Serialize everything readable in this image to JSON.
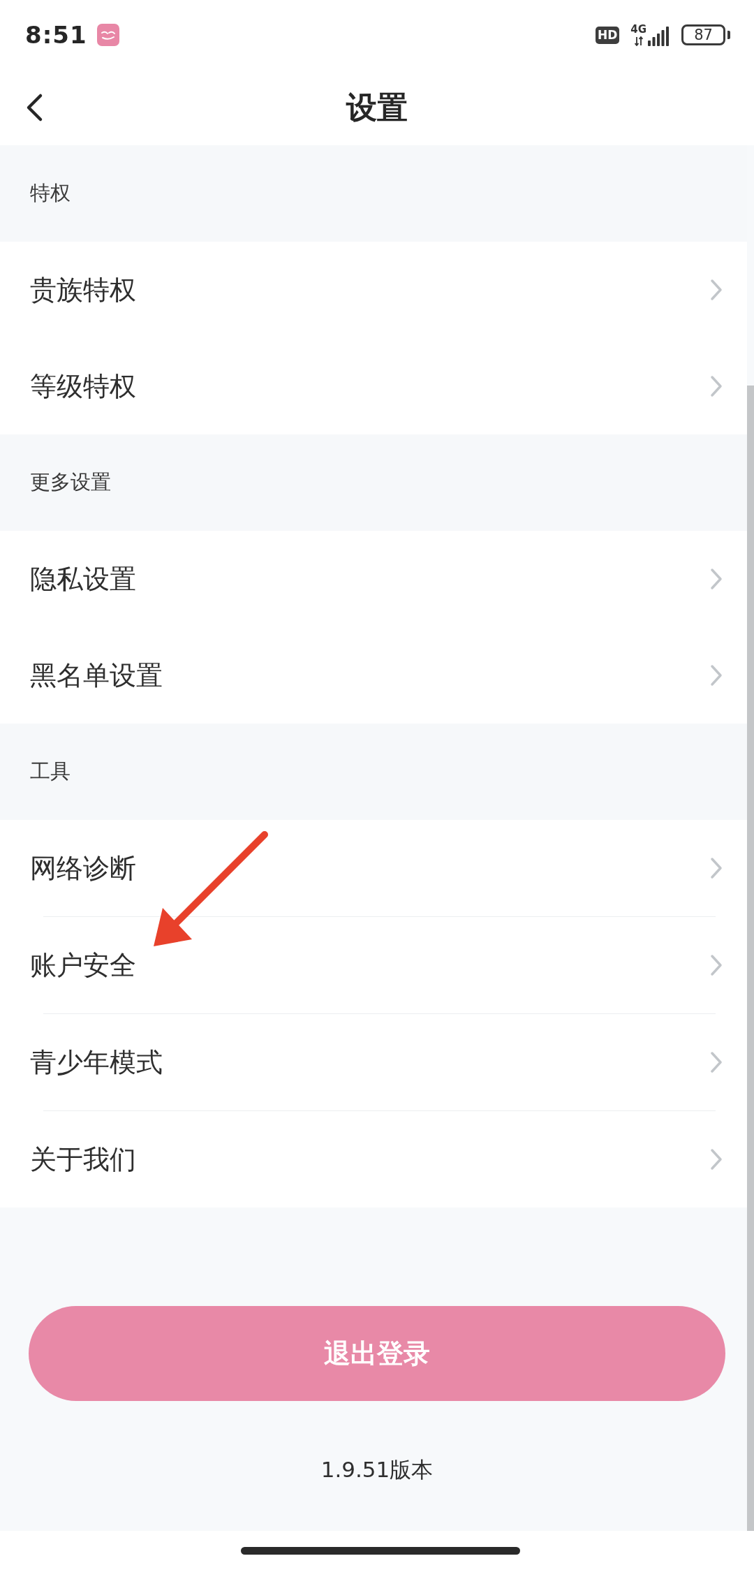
{
  "status_bar": {
    "time": "8:51",
    "hd": "HD",
    "network": "4G",
    "battery": "87"
  },
  "header": {
    "title": "设置"
  },
  "sections": [
    {
      "title": "特权",
      "dividers": false,
      "items": [
        {
          "label": "贵族特权"
        },
        {
          "label": "等级特权"
        }
      ]
    },
    {
      "title": "更多设置",
      "dividers": false,
      "items": [
        {
          "label": "隐私设置"
        },
        {
          "label": "黑名单设置"
        }
      ]
    },
    {
      "title": "工具",
      "dividers": true,
      "items": [
        {
          "label": "网络诊断"
        },
        {
          "label": "账户安全"
        },
        {
          "label": "青少年模式"
        },
        {
          "label": "关于我们"
        }
      ]
    }
  ],
  "logout_button": {
    "label": "退出登录"
  },
  "version": "1.9.51版本"
}
